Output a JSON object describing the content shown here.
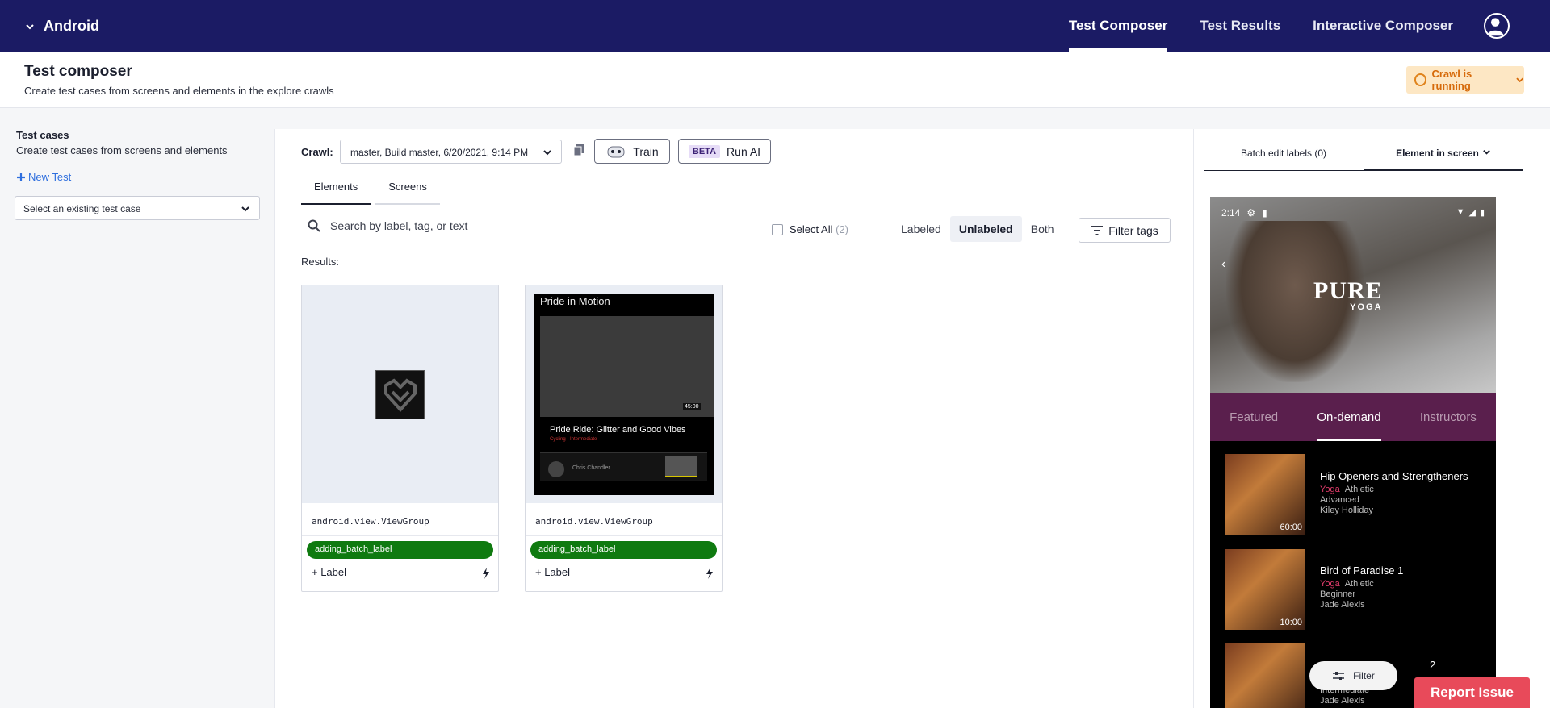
{
  "nav": {
    "project": "Android",
    "links": [
      "Test Composer",
      "Test Results",
      "Interactive Composer"
    ]
  },
  "header": {
    "title": "Test composer",
    "subtitle": "Create test cases from screens and elements in the explore crawls",
    "crawl_status": "Crawl is running"
  },
  "sidebar": {
    "title": "Test cases",
    "subtitle": "Create test cases from screens and elements",
    "new_test": "New Test",
    "select_placeholder": "Select an existing test case"
  },
  "main": {
    "crawl_label": "Crawl:",
    "crawl_value": "master, Build master, 6/20/2021, 9:14 PM",
    "train_label": "Train",
    "beta_badge": "BETA",
    "run_ai_label": "Run AI",
    "tabs": [
      "Elements",
      "Screens"
    ],
    "search_placeholder": "Search by label, tag, or text",
    "select_all": "Select All",
    "select_all_count": "(2)",
    "segments": [
      "Labeled",
      "Unlabeled",
      "Both"
    ],
    "filter_tags": "Filter tags",
    "results_label": "Results:",
    "cards": [
      {
        "class_name": "android.view.ViewGroup",
        "tag": "adding_batch_label",
        "add_label": "+ Label"
      },
      {
        "class_name": "android.view.ViewGroup",
        "tag": "adding_batch_label",
        "add_label": "+ Label",
        "preview": {
          "title": "Pride in Motion",
          "duration": "45:00",
          "caption": "Pride Ride: Glitter and Good Vibes",
          "category": "Cycling · Intermediate",
          "instructor": "Chris Chandler"
        }
      }
    ]
  },
  "right": {
    "tabs": [
      "Batch edit labels (0)",
      "Element in screen"
    ],
    "phone": {
      "time": "2:14",
      "logo_big": "PURE",
      "logo_small": "YOGA",
      "categories": [
        "Featured",
        "On-demand",
        "Instructors"
      ],
      "videos": [
        {
          "title": "Hip Openers and Strengtheners",
          "type": "Yoga",
          "style": "Athletic",
          "level": "Advanced",
          "instructor": "Kiley Holliday",
          "duration": "60:00"
        },
        {
          "title": "Bird of Paradise 1",
          "type": "Yoga",
          "style": "Athletic",
          "level": "Beginner",
          "instructor": "Jade Alexis",
          "duration": "10:00"
        },
        {
          "title": "2",
          "type": "",
          "style": "",
          "level": "Intermediate",
          "instructor": "Jade Alexis",
          "duration": ""
        }
      ],
      "filter": "Filter"
    }
  },
  "report_issue": "Report Issue",
  "colors": {
    "nav_bg": "#1b1b64",
    "tag_green": "#0f7a10",
    "crawl_status_bg": "#fde7c4",
    "crawl_status_fg": "#d66a0a",
    "category_bar": "#5a1f4d",
    "report_red": "#e84a5a"
  }
}
